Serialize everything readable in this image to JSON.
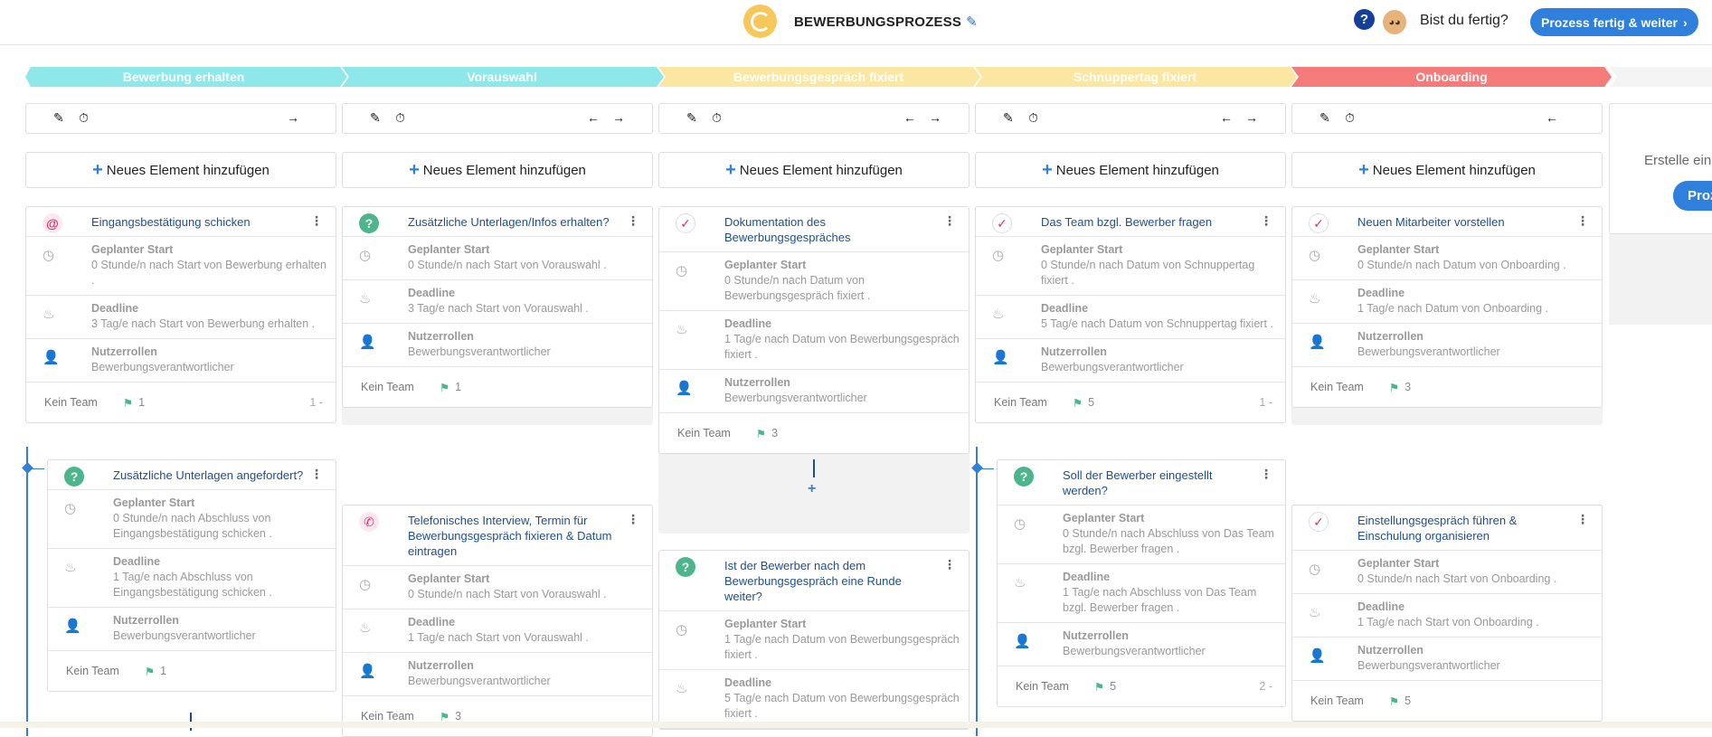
{
  "topbar": {
    "title": "BEWERBUNGSPROZESS",
    "help": "?",
    "ready_text": "Bist du fertig?",
    "finish_button": "Prozess fertig & weiter"
  },
  "stages": [
    {
      "label": "Bewerbung erhalten",
      "color": "#8ee8ea"
    },
    {
      "label": "Vorauswahl",
      "color": "#8ee8ea"
    },
    {
      "label": "Bewerbungsgespräch fixiert",
      "color": "#fbe7a1"
    },
    {
      "label": "Schnuppertag fixiert",
      "color": "#fbe7a1"
    },
    {
      "label": "Onboarding",
      "color": "#f57b7b"
    }
  ],
  "add_element_label": "Neues Element hinzufügen",
  "side_panel": {
    "text": "Erstelle eine",
    "button": "Proz"
  },
  "columns": [
    {
      "cards": [
        {
          "title": "Eingangsbestätigung schicken",
          "start_label": "Geplanter Start",
          "start": "0 Stunde/n nach Start von Bewerbung erhalten .",
          "deadline_label": "Deadline",
          "deadline": "3 Tag/e nach Start von Bewerbung erhalten .",
          "roles_label": "Nutzerrollen",
          "roles": "Bewerbungsverantwortlicher",
          "team": "Kein Team",
          "count": "1",
          "side": "1 -"
        },
        {
          "title": "Zusätzliche Unterlagen angefordert?",
          "start_label": "Geplanter Start",
          "start": "0 Stunde/n nach Abschluss von Eingangsbestätigung schicken .",
          "deadline_label": "Deadline",
          "deadline": "1 Tag/e nach Abschluss von Eingangsbestätigung schicken .",
          "roles_label": "Nutzerrollen",
          "roles": "Bewerbungsverantwortlicher",
          "team": "Kein Team",
          "count": "1"
        }
      ]
    },
    {
      "cards": [
        {
          "title": "Zusätzliche Unterlagen/Infos erhalten?",
          "start_label": "Geplanter Start",
          "start": "0 Stunde/n nach Start von Vorauswahl .",
          "deadline_label": "Deadline",
          "deadline": "3 Tag/e nach Start von Vorauswahl .",
          "roles_label": "Nutzerrollen",
          "roles": "Bewerbungsverantwortlicher",
          "team": "Kein Team",
          "count": "1"
        },
        {
          "title": "Telefonisches Interview, Termin für Bewerbungsgespräch fixieren & Datum eintragen",
          "start_label": "Geplanter Start",
          "start": "0 Stunde/n nach Start von Vorauswahl .",
          "deadline_label": "Deadline",
          "deadline": "1 Tag/e nach Start von Vorauswahl .",
          "roles_label": "Nutzerrollen",
          "roles": "Bewerbungsverantwortlicher",
          "team": "Kein Team",
          "count": "3"
        }
      ]
    },
    {
      "cards": [
        {
          "title": "Dokumentation des Bewerbungsgespräches",
          "start_label": "Geplanter Start",
          "start": "0 Stunde/n nach Datum von Bewerbungsgespräch fixiert .",
          "deadline_label": "Deadline",
          "deadline": "1 Tag/e nach Datum von Bewerbungsgespräch fixiert .",
          "roles_label": "Nutzerrollen",
          "roles": "Bewerbungsverantwortlicher",
          "team": "Kein Team",
          "count": "3"
        },
        {
          "title": "Ist der Bewerber nach dem Bewerbungsgespräch eine Runde weiter?",
          "start_label": "Geplanter Start",
          "start": "1 Tag/e nach Datum von Bewerbungsgespräch fixiert .",
          "deadline_label": "Deadline",
          "deadline": "5 Tag/e nach Datum von Bewerbungsgespräch fixiert ."
        }
      ]
    },
    {
      "cards": [
        {
          "title": "Das Team bzgl. Bewerber fragen",
          "start_label": "Geplanter Start",
          "start": "0 Stunde/n nach Datum von Schnuppertag fixiert .",
          "deadline_label": "Deadline",
          "deadline": "5 Tag/e nach Datum von Schnuppertag fixiert .",
          "roles_label": "Nutzerrollen",
          "roles": "Bewerbungsverantwortlicher",
          "team": "Kein Team",
          "count": "5",
          "side": "1 -"
        },
        {
          "title": "Soll der Bewerber eingestellt werden?",
          "start_label": "Geplanter Start",
          "start": "0 Stunde/n nach Abschluss von Das Team bzgl. Bewerber fragen .",
          "deadline_label": "Deadline",
          "deadline": "1 Tag/e nach Abschluss von Das Team bzgl. Bewerber fragen .",
          "roles_label": "Nutzerrollen",
          "roles": "Bewerbungsverantwortlicher",
          "team": "Kein Team",
          "count": "5",
          "side": "2 -"
        }
      ]
    },
    {
      "cards": [
        {
          "title": "Neuen Mitarbeiter vorstellen",
          "start_label": "Geplanter Start",
          "start": "0 Stunde/n nach Datum von Onboarding .",
          "deadline_label": "Deadline",
          "deadline": "1 Tag/e nach Datum von Onboarding .",
          "roles_label": "Nutzerrollen",
          "roles": "Bewerbungsverantwortlicher",
          "team": "Kein Team",
          "count": "3"
        },
        {
          "title": "Einstellungsgespräch führen & Einschulung organisieren",
          "start_label": "Geplanter Start",
          "start": "0 Stunde/n nach Start von Onboarding .",
          "deadline_label": "Deadline",
          "deadline": "1 Tag/e nach Start von Onboarding .",
          "roles_label": "Nutzerrollen",
          "roles": "Bewerbungsverantwortlicher",
          "team": "Kein Team",
          "count": "5"
        }
      ]
    }
  ]
}
